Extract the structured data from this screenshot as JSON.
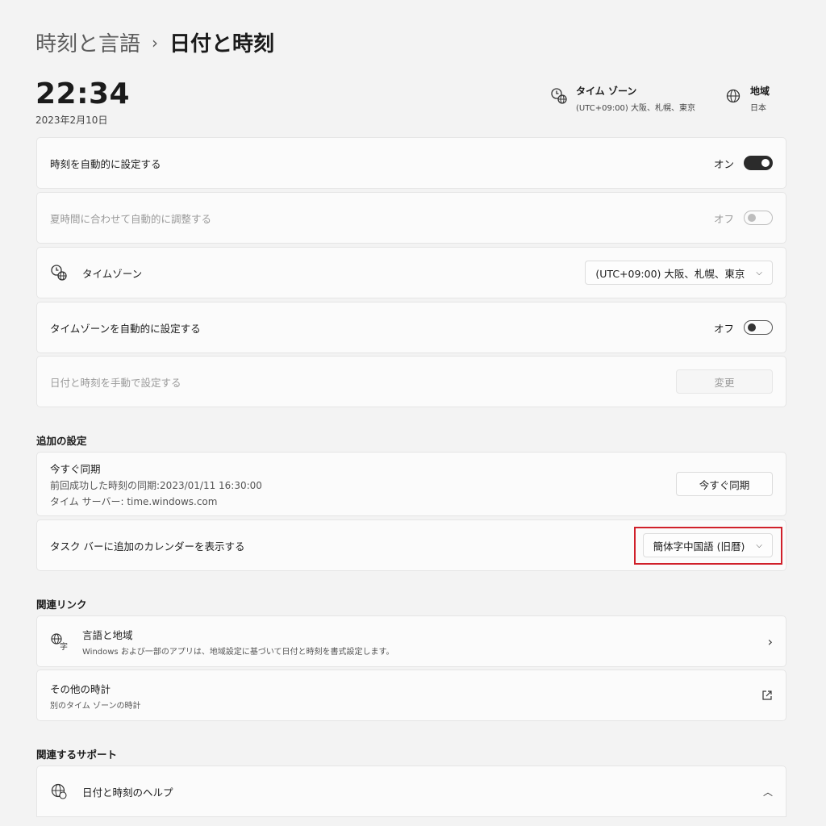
{
  "breadcrumb": {
    "parent": "時刻と言語",
    "separator": "›",
    "current": "日付と時刻"
  },
  "clock": {
    "time": "22:34",
    "date": "2023年2月10日"
  },
  "header_info": {
    "timezone": {
      "title": "タイム ゾーン",
      "value": "(UTC+09:00) 大阪、札幌、東京",
      "icon": "clock-globe-icon"
    },
    "region": {
      "title": "地域",
      "value": "日本",
      "icon": "globe-icon"
    }
  },
  "settings": {
    "auto_time": {
      "label": "時刻を自動的に設定する",
      "state_text": "オン",
      "on": true
    },
    "dst": {
      "label": "夏時間に合わせて自動的に調整する",
      "state_text": "オフ",
      "on": false,
      "disabled": true
    },
    "timezone": {
      "label": "タイムゾーン",
      "value": "(UTC+09:00) 大阪、札幌、東京",
      "icon": "clock-globe-icon"
    },
    "auto_timezone": {
      "label": "タイムゾーンを自動的に設定する",
      "state_text": "オフ",
      "on": false
    },
    "manual": {
      "label": "日付と時刻を手動で設定する",
      "button": "変更",
      "disabled": true
    }
  },
  "additional": {
    "title": "追加の設定",
    "sync": {
      "title": "今すぐ同期",
      "last_sync": "前回成功した時刻の同期:2023/01/11 16:30:00",
      "server": "タイム サーバー: time.windows.com",
      "button": "今すぐ同期"
    },
    "calendar": {
      "label": "タスク バーに追加のカレンダーを表示する",
      "value": "簡体字中国語 (旧暦)"
    }
  },
  "related_links": {
    "title": "関連リンク",
    "language_region": {
      "title": "言語と地域",
      "desc": "Windows および一部のアプリは、地域設定に基づいて日付と時刻を書式設定します。",
      "icon": "language-icon"
    },
    "other_clocks": {
      "title": "その他の時計",
      "desc": "別のタイム ゾーンの時計",
      "icon": "external-link-icon"
    }
  },
  "support": {
    "title": "関連するサポート",
    "help": {
      "title": "日付と時刻のヘルプ",
      "icon": "globe-help-icon"
    }
  },
  "colors": {
    "background": "#f3f3f3",
    "card": "#fbfbfb",
    "highlight": "#d0202a",
    "toggle_on": "#2b2b2b"
  }
}
